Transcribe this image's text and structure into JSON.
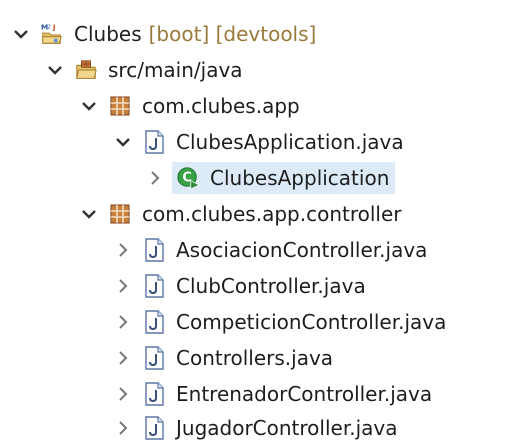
{
  "project": {
    "name": "Clubes",
    "decorations": "[boot] [devtools]"
  },
  "source_folder": "src/main/java",
  "packages": [
    {
      "name": "com.clubes.app",
      "files": [
        {
          "name": "ClubesApplication.java",
          "class": "ClubesApplication"
        }
      ]
    },
    {
      "name": "com.clubes.app.controller",
      "files": [
        {
          "name": "AsociacionController.java"
        },
        {
          "name": "ClubController.java"
        },
        {
          "name": "CompeticionController.java"
        },
        {
          "name": "Controllers.java"
        },
        {
          "name": "EntrenadorController.java"
        },
        {
          "name": "JugadorController.java"
        }
      ]
    }
  ],
  "icons": {
    "expanded": "chevron-down-icon",
    "collapsed": "chevron-right-icon",
    "project": "maven-project-icon",
    "source_folder": "source-folder-icon",
    "package": "package-icon",
    "java_file": "java-file-icon",
    "spring_class": "spring-boot-class-icon"
  },
  "colors": {
    "selection": "#ddebf8",
    "decorations": "#9a7a3a",
    "package": "#a05a28",
    "java_file": "#5b76a8",
    "spring": "#38a045"
  }
}
